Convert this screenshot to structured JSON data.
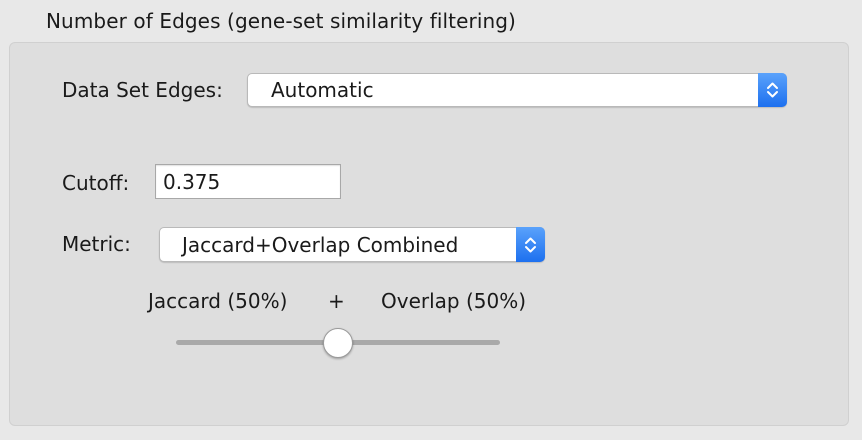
{
  "group": {
    "title": "Number of Edges (gene-set similarity filtering)"
  },
  "data_set_edges": {
    "label": "Data Set Edges:",
    "selected": "Automatic"
  },
  "cutoff": {
    "label": "Cutoff:",
    "value": "0.375"
  },
  "metric": {
    "label": "Metric:",
    "selected": "Jaccard+Overlap Combined"
  },
  "combined_slider": {
    "left_label": "Jaccard (50%)",
    "plus": "+",
    "right_label": "Overlap (50%)",
    "value_fraction": 0.5
  },
  "colors": {
    "stepper_accent": "#1d70ef"
  },
  "icons": {
    "stepper": "up-down-chevron-icon"
  }
}
